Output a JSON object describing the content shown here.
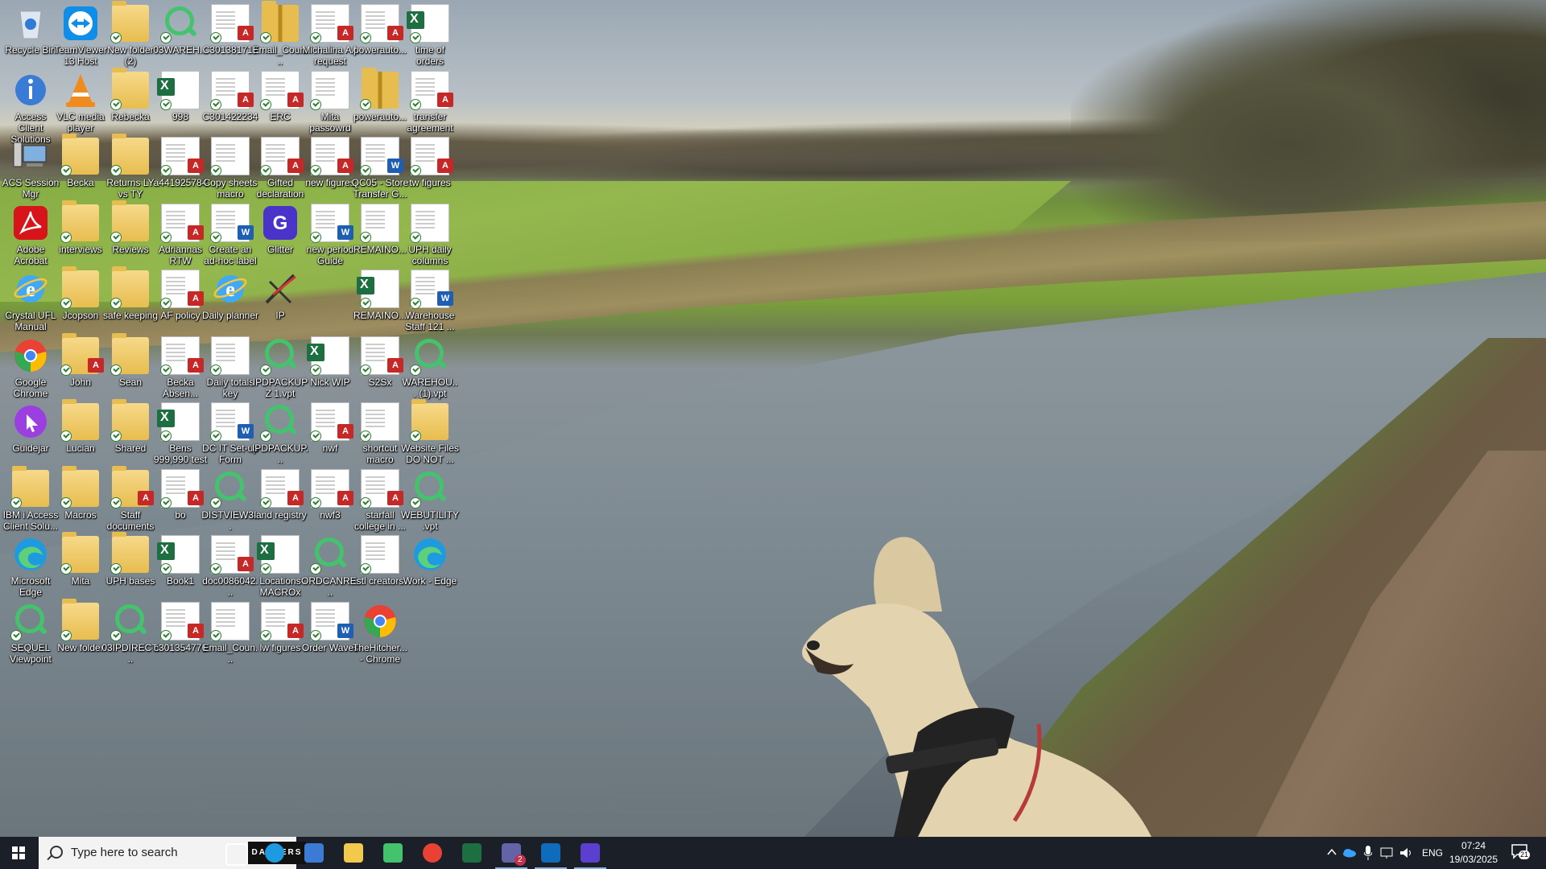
{
  "desktop": {
    "icons": [
      {
        "label": "Recycle Bin",
        "kind": "recycle"
      },
      {
        "label": "TeamViewer 13 Host",
        "kind": "teamviewer"
      },
      {
        "label": "New folder (2)",
        "kind": "folder"
      },
      {
        "label": "03WAREH...",
        "kind": "search"
      },
      {
        "label": "C301381717",
        "kind": "pdf"
      },
      {
        "label": "Email_Coun...",
        "kind": "zip"
      },
      {
        "label": "Michalina AA request",
        "kind": "pdf"
      },
      {
        "label": "powerauto...",
        "kind": "pdf"
      },
      {
        "label": "time of orders",
        "kind": "excel"
      },
      {
        "label": "Access Client Solutions",
        "kind": "info"
      },
      {
        "label": "VLC media player",
        "kind": "vlc"
      },
      {
        "label": "Rebecka",
        "kind": "folder"
      },
      {
        "label": "998",
        "kind": "excel"
      },
      {
        "label": "C301422234",
        "kind": "pdf"
      },
      {
        "label": "ERC",
        "kind": "pdf"
      },
      {
        "label": "Mita passowrd",
        "kind": "doc"
      },
      {
        "label": "powerauto...",
        "kind": "zip"
      },
      {
        "label": "transfer agreement",
        "kind": "pdf"
      },
      {
        "label": "ACS Session Mgr",
        "kind": "computers"
      },
      {
        "label": "Becka",
        "kind": "folder"
      },
      {
        "label": "Returns LY vs TY",
        "kind": "folder"
      },
      {
        "label": "a441925784",
        "kind": "pdf"
      },
      {
        "label": "Copy sheets macro",
        "kind": "doc"
      },
      {
        "label": "Gifted declaration",
        "kind": "pdf"
      },
      {
        "label": "new figures",
        "kind": "pdf"
      },
      {
        "label": "QC05 - Store Transfer G...",
        "kind": "word"
      },
      {
        "label": "tw figures",
        "kind": "pdf"
      },
      {
        "label": "Adobe Acrobat",
        "kind": "acrobat"
      },
      {
        "label": "interviews",
        "kind": "folder"
      },
      {
        "label": "Reviews",
        "kind": "folder"
      },
      {
        "label": "Adriannas RTW",
        "kind": "pdf"
      },
      {
        "label": "Create an ad-hoc label",
        "kind": "word"
      },
      {
        "label": "Glitter",
        "kind": "glitter"
      },
      {
        "label": "new period Guide",
        "kind": "word"
      },
      {
        "label": "REMAINO...",
        "kind": "doc"
      },
      {
        "label": "UPH daily columns",
        "kind": "doc"
      },
      {
        "label": "Crystal UFL Manual",
        "kind": "ie"
      },
      {
        "label": "Jcopson",
        "kind": "folder"
      },
      {
        "label": "safe keeping",
        "kind": "folder"
      },
      {
        "label": "AF policy",
        "kind": "pdf"
      },
      {
        "label": "Daily planner",
        "kind": "ie"
      },
      {
        "label": "IP",
        "kind": "ip"
      },
      {
        "label": "",
        "kind": "none"
      },
      {
        "label": "REMAINO...",
        "kind": "excel"
      },
      {
        "label": "Warehouse Staff 121 ...",
        "kind": "word"
      },
      {
        "label": "Google Chrome",
        "kind": "chrome"
      },
      {
        "label": "John",
        "kind": "folderpdf"
      },
      {
        "label": "Sean",
        "kind": "folder"
      },
      {
        "label": "Becka Absen...",
        "kind": "pdf"
      },
      {
        "label": "Daily totals key",
        "kind": "doc"
      },
      {
        "label": "IPDPACKUPZ 1.vpt",
        "kind": "search"
      },
      {
        "label": "Nick WIP",
        "kind": "excel"
      },
      {
        "label": "S2Sx",
        "kind": "pdf"
      },
      {
        "label": "WAREHOU... (1).vpt",
        "kind": "search"
      },
      {
        "label": "Guidejar",
        "kind": "guidejar"
      },
      {
        "label": "Lucian",
        "kind": "folder"
      },
      {
        "label": "Shared",
        "kind": "folder"
      },
      {
        "label": "Bens 999,990 test",
        "kind": "excel"
      },
      {
        "label": "DC IT Set-up Form",
        "kind": "word"
      },
      {
        "label": "IPDPACKUP...",
        "kind": "search"
      },
      {
        "label": "nwf",
        "kind": "pdf"
      },
      {
        "label": "shortcut macro",
        "kind": "doc"
      },
      {
        "label": "Website Files DO NOT ...",
        "kind": "folder"
      },
      {
        "label": "IBM i Access Client Solu...",
        "kind": "folder"
      },
      {
        "label": "Macros",
        "kind": "folder"
      },
      {
        "label": "Staff documents",
        "kind": "folderpdf"
      },
      {
        "label": "bo",
        "kind": "pdf"
      },
      {
        "label": "DISTVIEW3...",
        "kind": "search"
      },
      {
        "label": "land registry",
        "kind": "pdf"
      },
      {
        "label": "nwf3",
        "kind": "pdf"
      },
      {
        "label": "starfall college in ...",
        "kind": "pdf"
      },
      {
        "label": "WEBUTILITY .vpt",
        "kind": "search"
      },
      {
        "label": "Microsoft Edge",
        "kind": "edge"
      },
      {
        "label": "Mita",
        "kind": "folder"
      },
      {
        "label": "UPH bases",
        "kind": "folder"
      },
      {
        "label": "Book1",
        "kind": "excel"
      },
      {
        "label": "doc0086042...",
        "kind": "pdf"
      },
      {
        "label": "Locations MACROx",
        "kind": "excel"
      },
      {
        "label": "ORDCANRE...",
        "kind": "search"
      },
      {
        "label": "stl creators",
        "kind": "doc"
      },
      {
        "label": "Work - Edge",
        "kind": "edge"
      },
      {
        "label": "SEQUEL Viewpoint",
        "kind": "search"
      },
      {
        "label": "New folder",
        "kind": "folder"
      },
      {
        "label": "03IPDIRECT...",
        "kind": "search"
      },
      {
        "label": "c301354776",
        "kind": "pdf"
      },
      {
        "label": "Email_Coun...",
        "kind": "doc"
      },
      {
        "label": "lw figures",
        "kind": "pdf"
      },
      {
        "label": "Order Waves",
        "kind": "word"
      },
      {
        "label": "TheHitcher... - Chrome",
        "kind": "chrome"
      },
      {
        "label": "",
        "kind": "none"
      }
    ]
  },
  "taskbar": {
    "search_placeholder": "Type here to search",
    "search_promo": "DANVERS",
    "apps": [
      {
        "name": "task-view",
        "color": "#ffffff"
      },
      {
        "name": "edge",
        "color": "#1e9be0"
      },
      {
        "name": "store",
        "color": "#3b7bd4"
      },
      {
        "name": "file-explorer",
        "color": "#f2c94c"
      },
      {
        "name": "search-app",
        "color": "#43c46c"
      },
      {
        "name": "chrome",
        "color": "#e94235"
      },
      {
        "name": "excel",
        "color": "#1d6f42"
      },
      {
        "name": "teams",
        "color": "#6264a7",
        "badge": "2"
      },
      {
        "name": "outlook",
        "color": "#0f6cbd"
      },
      {
        "name": "glitter",
        "color": "#5b3fd1"
      }
    ],
    "language": "ENG",
    "time": "07:24",
    "date": "19/03/2025",
    "notifications": "21"
  },
  "colors": {
    "taskbar": "#1b1f28",
    "accent": "#8fb3e8"
  }
}
